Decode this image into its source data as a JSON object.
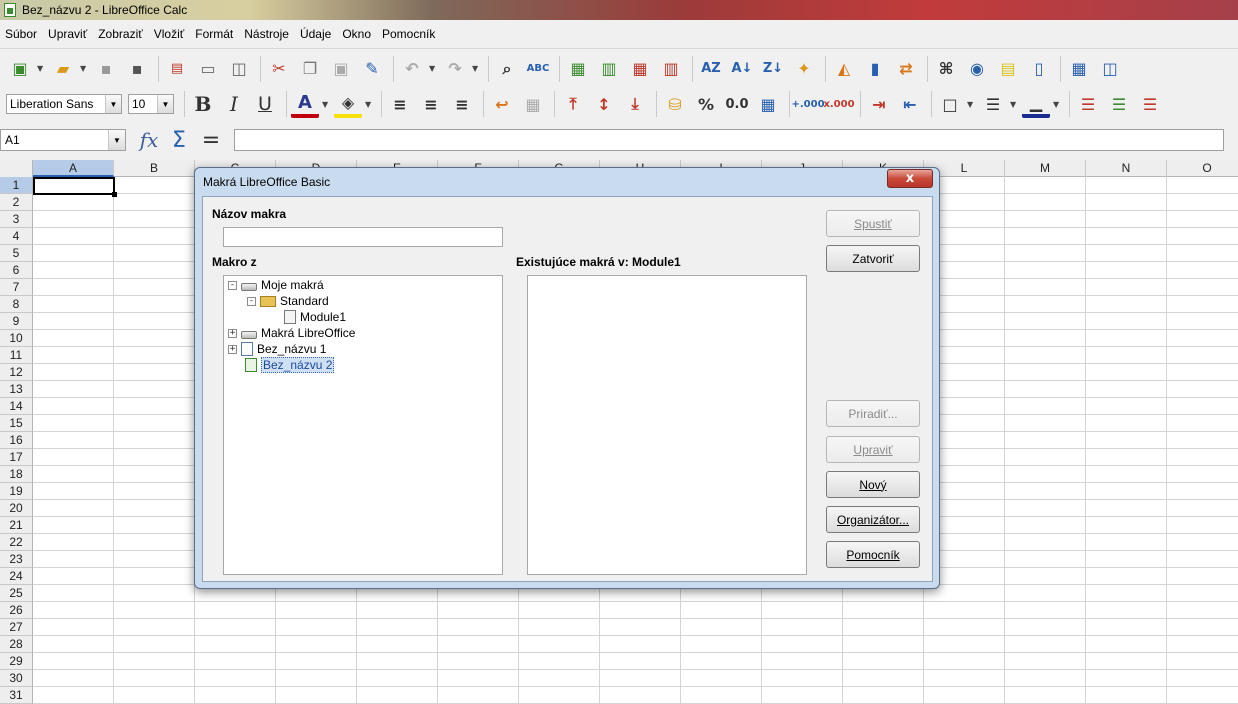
{
  "window": {
    "title": "Bez_názvu 2 - LibreOffice Calc"
  },
  "menu": [
    "Súbor",
    "Upraviť",
    "Zobraziť",
    "Vložiť",
    "Formát",
    "Nástroje",
    "Údaje",
    "Okno",
    "Pomocník"
  ],
  "toolbar": {
    "font_name": "Liberation Sans",
    "font_size": "10",
    "bold": "B",
    "italic": "I",
    "underline": "U",
    "font_color": "A",
    "percent": "%",
    "number_format": "0.0",
    "add_decimal": "+.000",
    "remove_decimal": "x.000",
    "spellcheck": "ABC"
  },
  "formula_bar": {
    "name_box": "A1",
    "fx": "fx",
    "sum": "Σ",
    "equals": "="
  },
  "sheet": {
    "columns": [
      "A",
      "B",
      "C",
      "D",
      "E",
      "F",
      "G",
      "H",
      "I",
      "J",
      "K",
      "L",
      "M",
      "N",
      "O"
    ],
    "active_column": "A",
    "rows": [
      "1",
      "2",
      "3",
      "4",
      "5",
      "6",
      "7",
      "8",
      "9",
      "10",
      "11",
      "12",
      "13",
      "14",
      "15",
      "16",
      "17",
      "18",
      "19",
      "20",
      "21",
      "22",
      "23",
      "24",
      "25",
      "26",
      "27",
      "28",
      "29",
      "30",
      "31"
    ],
    "active_row": "1",
    "active_cell": "A1"
  },
  "dialog": {
    "title": "Makrá LibreOffice Basic",
    "close": "x",
    "macro_name_label": "Názov makra",
    "macro_name_value": "",
    "macro_from_label": "Makro z",
    "existing_label": "Existujúce makrá v: Module1",
    "tree": [
      {
        "label": "Moje makrá",
        "expander": "-",
        "icon": "drive-icon",
        "depth": 0
      },
      {
        "label": "Standard",
        "expander": "-",
        "icon": "folder-icon",
        "depth": 1
      },
      {
        "label": "Module1",
        "expander": "",
        "icon": "module-icon",
        "depth": 2
      },
      {
        "label": "Makrá LibreOffice",
        "expander": "+",
        "icon": "drive-icon",
        "depth": 0
      },
      {
        "label": "Bez_názvu 1",
        "expander": "+",
        "icon": "document-icon",
        "depth": 0
      },
      {
        "label": "Bez_názvu 2",
        "expander": "",
        "icon": "calc-document-icon",
        "depth": 0,
        "selected": true
      }
    ],
    "existing_macros": [],
    "buttons": {
      "run": "Spustiť",
      "close": "Zatvoriť",
      "assign": "Priradiť...",
      "edit": "Upraviť",
      "new": "Nový",
      "organizer": "Organizátor...",
      "help": "Pomocník"
    },
    "disabled_buttons": [
      "run",
      "assign",
      "edit"
    ]
  }
}
